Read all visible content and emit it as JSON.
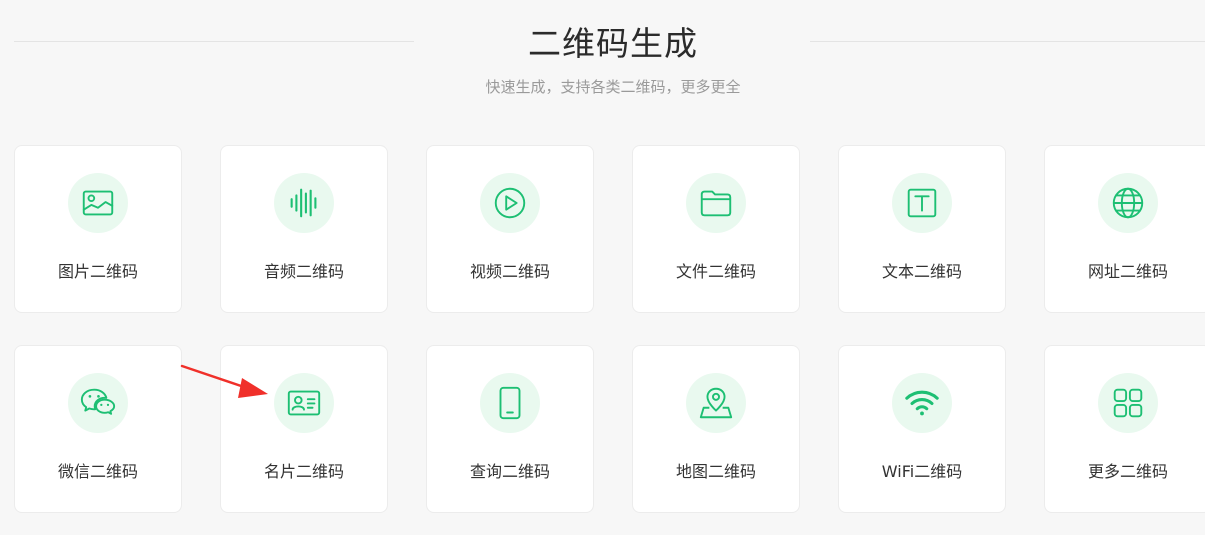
{
  "header": {
    "title": "二维码生成",
    "subtitle": "快速生成，支持各类二维码，更多更全"
  },
  "accent_color": "#1dbf73",
  "icon_bg_color": "#e9f9ef",
  "cards": [
    {
      "label": "图片二维码",
      "icon": "image-icon"
    },
    {
      "label": "音频二维码",
      "icon": "audio-wave-icon"
    },
    {
      "label": "视频二维码",
      "icon": "play-circle-icon"
    },
    {
      "label": "文件二维码",
      "icon": "folder-icon"
    },
    {
      "label": "文本二维码",
      "icon": "text-box-icon"
    },
    {
      "label": "网址二维码",
      "icon": "globe-icon"
    },
    {
      "label": "微信二维码",
      "icon": "wechat-icon"
    },
    {
      "label": "名片二维码",
      "icon": "id-card-icon"
    },
    {
      "label": "查询二维码",
      "icon": "phone-icon"
    },
    {
      "label": "地图二维码",
      "icon": "map-pin-icon"
    },
    {
      "label": "WiFi二维码",
      "icon": "wifi-icon"
    },
    {
      "label": "更多二维码",
      "icon": "grid-icon"
    }
  ],
  "annotation": {
    "icon": "red-arrow-icon",
    "color": "#f0302a"
  }
}
